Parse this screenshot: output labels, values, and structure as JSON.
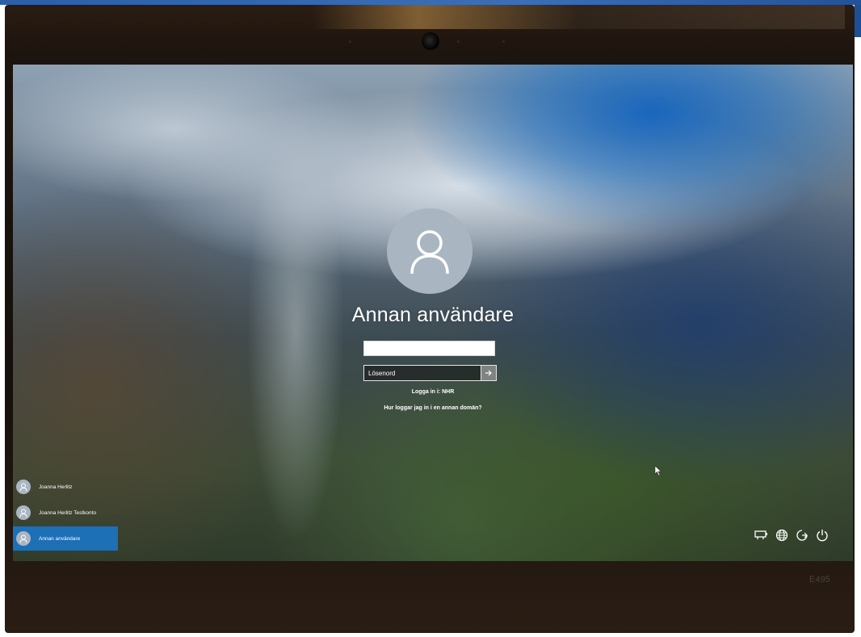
{
  "login": {
    "title": "Annan användare",
    "username_value": "",
    "password_placeholder": "Lösenord",
    "signin_to": "Logga in i: NHR",
    "domain_help_link": "Hur loggar jag in i en annan domän?"
  },
  "users": [
    {
      "name": "Joanna Herlitz",
      "selected": false
    },
    {
      "name": "Joanna Herlitz Testkonto",
      "selected": false
    },
    {
      "name": "Annan användare",
      "selected": true
    }
  ],
  "system_icons": [
    "network-icon",
    "globe-icon",
    "accessibility-icon",
    "power-icon"
  ],
  "bezel": {
    "model_label": "E495"
  },
  "colors": {
    "selected_user_bg": "#1d6fb6",
    "avatar_bg": "#a9b6c2"
  }
}
